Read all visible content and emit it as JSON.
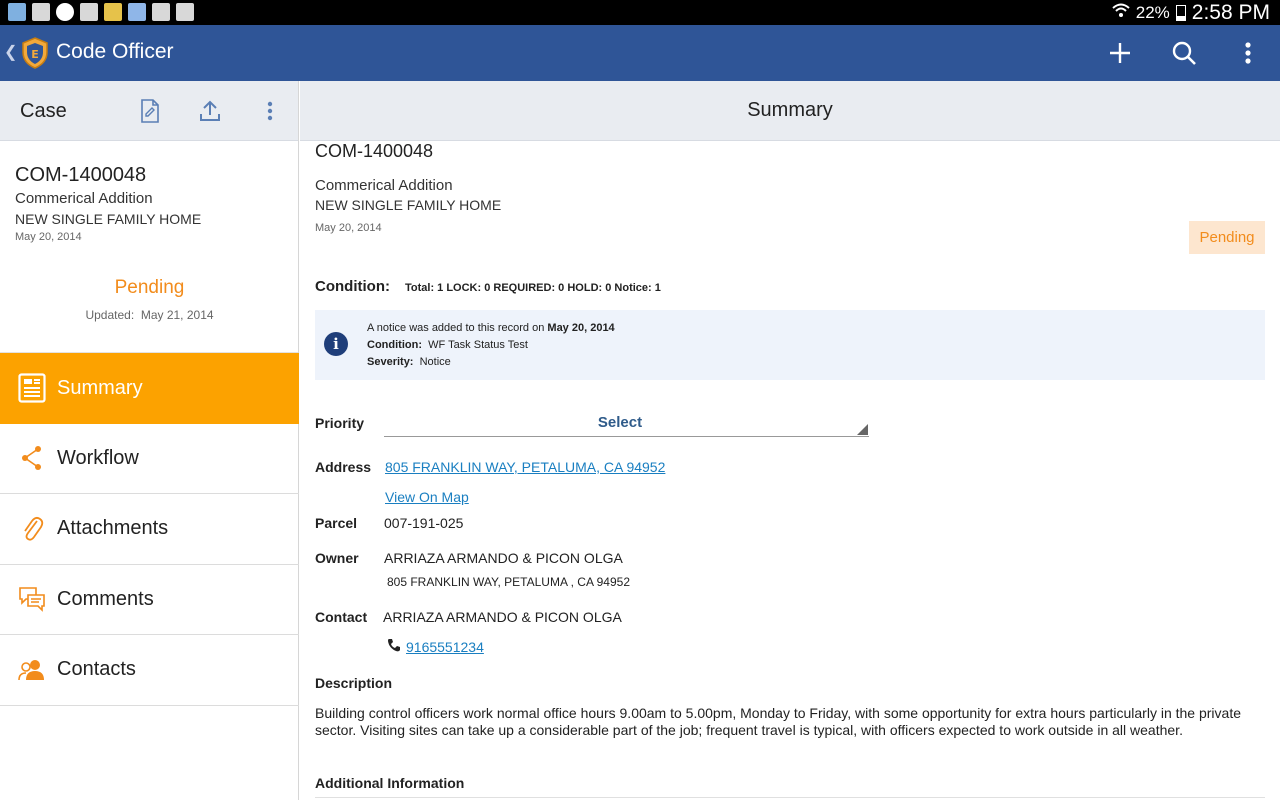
{
  "status_bar": {
    "battery": "22%",
    "time": "2:58 PM"
  },
  "app_bar": {
    "title": "Code Officer"
  },
  "left_panel": {
    "header": "Case",
    "record": {
      "id": "COM-1400048",
      "line1": "Commerical Addition",
      "line2": "NEW SINGLE FAMILY HOME",
      "date": "May 20, 2014",
      "status": "Pending",
      "updated_label": "Updated:",
      "updated_date": "May 21, 2014"
    },
    "nav": [
      {
        "label": "Summary",
        "icon": "summary-icon",
        "active": true
      },
      {
        "label": "Workflow",
        "icon": "workflow-icon"
      },
      {
        "label": "Attachments",
        "icon": "paperclip-icon"
      },
      {
        "label": "Comments",
        "icon": "comments-icon"
      },
      {
        "label": "Contacts",
        "icon": "contacts-icon"
      }
    ]
  },
  "main": {
    "header": "Summary",
    "record": {
      "id": "COM-1400048",
      "line1": "Commerical Addition",
      "line2": "NEW SINGLE FAMILY HOME",
      "date": "May 20, 2014",
      "status_badge": "Pending"
    },
    "condition": {
      "label": "Condition:",
      "summary": "Total: 1 LOCK: 0 REQUIRED: 0 HOLD: 0 Notice: 1"
    },
    "notice": {
      "text_prefix": "A notice was added to this record on",
      "date": "May 20, 2014",
      "condition_label": "Condition:",
      "condition_value": "WF Task Status Test",
      "severity_label": "Severity:",
      "severity_value": "Notice"
    },
    "priority": {
      "label": "Priority",
      "value": "Select"
    },
    "address": {
      "label": "Address",
      "value": "805 FRANKLIN WAY, PETALUMA, CA 94952",
      "map_link": "View On Map"
    },
    "parcel": {
      "label": "Parcel",
      "value": "007-191-025"
    },
    "owner": {
      "label": "Owner",
      "name": "ARRIAZA ARMANDO & PICON OLGA",
      "address": "805 FRANKLIN WAY, PETALUMA , CA 94952"
    },
    "contact": {
      "label": "Contact",
      "name": "ARRIAZA ARMANDO & PICON OLGA",
      "phone": "9165551234"
    },
    "description": {
      "label": "Description",
      "text": "Building control officers work normal office hours 9.00am to 5.00pm, Monday to Friday, with some opportunity for extra hours particularly in the private sector. Visiting sites can take up a considerable part of the job; frequent travel is typical, with officers expected to work outside in all weather."
    },
    "additional_info": {
      "label": "Additional Information"
    }
  },
  "colors": {
    "app_bar": "#2f5597",
    "accent": "#fca200",
    "pending": "#f28c1c",
    "link": "#1a7fc1"
  }
}
